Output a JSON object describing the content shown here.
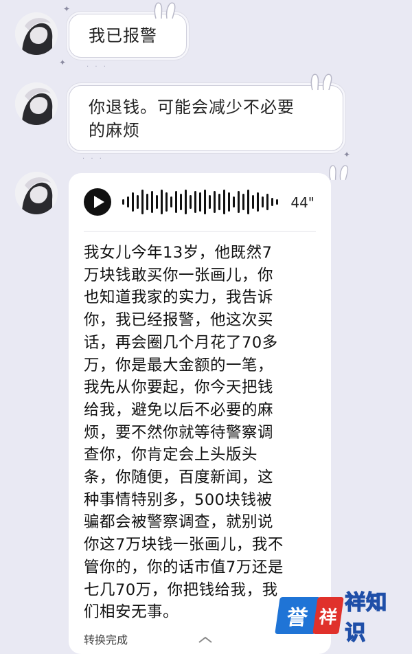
{
  "messages": [
    {
      "text": "我已报警"
    },
    {
      "text": "你退钱。可能会减少不必要\n的麻烦"
    }
  ],
  "voice_message": {
    "duration": "44\"",
    "transcript": "我女儿今年13岁，他既然7\n万块钱敢买你一张画儿，你\n也知道我家的实力，我告诉\n你，我已经报警，他这次买\n话，再会圈几个月花了70多\n万，你是最大金额的一笔，\n我先从你要起，你今天把钱\n给我，避免以后不必要的麻\n烦，要不然你就等待警察调\n查你，你肯定会上头版头\n条，你随便，百度新闻，这\n种事情特别多，500块钱被\n骗都会被警察调查，就别说\n你这7万块钱一张画儿，我不\n管你的，你的话市值7万还是\n七几70万，你把钱给我，我\n们相安无事。",
    "status": "转换完成"
  },
  "watermark": {
    "badge_1": "誉",
    "badge_2": "祥",
    "text": "祥知识"
  },
  "colors": {
    "background": "#e9e9f3",
    "bubble": "#ffffff",
    "watermark_blue": "#1f74d6",
    "watermark_red": "#e0312b"
  },
  "icons": [
    "avatar-image",
    "play-icon",
    "waveform-icon",
    "collapse-chevron-icon"
  ]
}
